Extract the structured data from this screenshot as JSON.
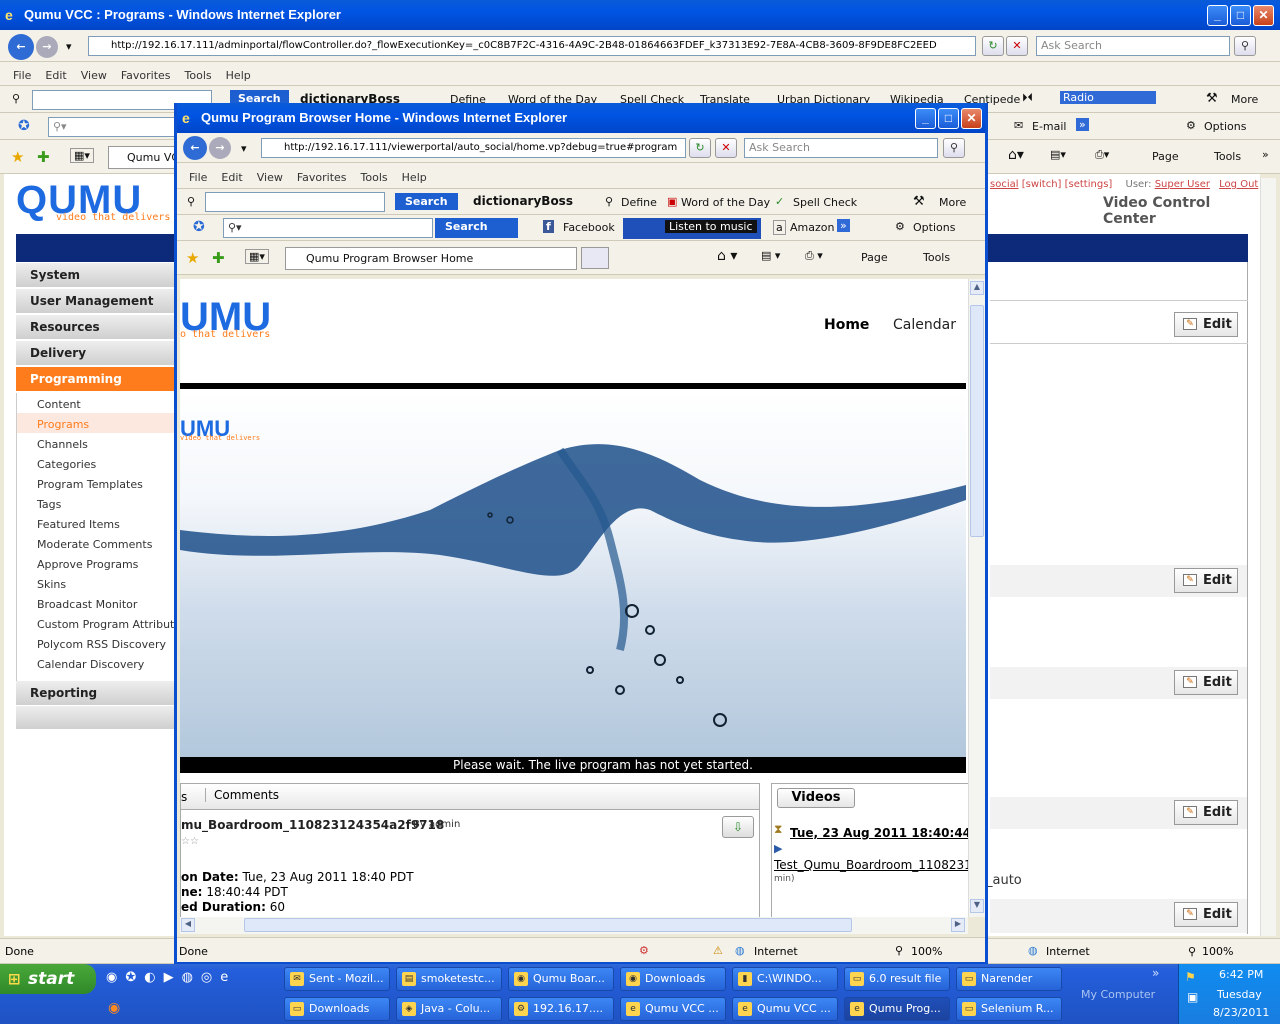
{
  "back": {
    "title": "Qumu VCC : Programs - Windows Internet Explorer",
    "url": "http://192.16.17.111/adminportal/flowController.do?_flowExecutionKey=_c0C8B7F2C-4316-4A9C-2B48-01864663FDEF_k37313E92-7E8A-4CB8-3609-8F9DE8FC2EED",
    "search_placeholder": "Ask Search",
    "menu": [
      "File",
      "Edit",
      "View",
      "Favorites",
      "Tools",
      "Help"
    ],
    "toolbar_search": "Search",
    "toolbar_items": [
      "dictionaryBoss",
      "Define",
      "Word of the Day",
      "Spell Check",
      "Translate",
      "Urban Dictionary",
      "Wikipedia",
      "Centipede"
    ],
    "radio": "Radio",
    "more": "More",
    "email": "E-mail",
    "options": "Options",
    "tab": "Qumu VC",
    "cmd": {
      "page": "Page",
      "tools": "Tools"
    },
    "header_links": {
      "social": "social",
      "switch": "[switch]",
      "settings": "[settings]",
      "user_label": "User:",
      "user": "Super User",
      "logout": "Log Out"
    },
    "app_title": "Video Control Center",
    "logo": "QUMU",
    "logo_tag": "video that delivers",
    "nav": [
      "System",
      "User Management",
      "Resources",
      "Delivery",
      "Programming"
    ],
    "subnav": [
      "Content",
      "Programs",
      "Channels",
      "Categories",
      "Program Templates",
      "Tags",
      "Featured Items",
      "Moderate Comments",
      "Approve Programs",
      "Skins",
      "Broadcast Monitor",
      "Custom Program Attributes",
      "Polycom RSS Discovery",
      "Calendar Discovery"
    ],
    "reporting": "Reporting",
    "edit": "Edit",
    "auto": "_auto",
    "status_done": "Done",
    "zone": "Internet",
    "zoom": "100%"
  },
  "front": {
    "title": "Qumu Program Browser Home - Windows Internet Explorer",
    "url": "http://192.16.17.111/viewerportal/auto_social/home.vp?debug=true#program",
    "search_placeholder": "Ask Search",
    "menu": [
      "File",
      "Edit",
      "View",
      "Favorites",
      "Tools",
      "Help"
    ],
    "search_btn": "Search",
    "toolbar_items": [
      "dictionaryBoss",
      "Define",
      "Word of the Day",
      "Spell Check"
    ],
    "more": "More",
    "search_ask": "Search",
    "facebook": "Facebook",
    "listen": "Listen to music",
    "amazon": "Amazon",
    "options": "Options",
    "tab": "Qumu Program Browser Home",
    "cmd": {
      "page": "Page",
      "tools": "Tools"
    },
    "logo": "UMU",
    "logo_tag": "o that delivers",
    "nav": {
      "home": "Home",
      "calendar": "Calendar"
    },
    "banner_logo": "UMU",
    "banner_tag": "video that delivers",
    "player_msg": "Please wait. The live program has not yet started.",
    "tabs": {
      "left": "s",
      "comments": "Comments",
      "videos": "Videos"
    },
    "program": {
      "title": "mu_Boardroom_110823124354a2f9718",
      "by": "By admin",
      "rating": "☆☆",
      "lines": [
        {
          "k": "on Date:",
          "v": "Tue, 23 Aug 2011 18:40 PDT"
        },
        {
          "k": "ne:",
          "v": "18:40:44 PDT"
        },
        {
          "k": "ed Duration:",
          "v": "60"
        }
      ]
    },
    "video": {
      "date": "Tue, 23 Aug 2011 18:40:44 PDT",
      "name": "Test_Qumu_Boardroom_1108231",
      "meta": "min)"
    },
    "status_done": "Done",
    "zone": "Internet",
    "zoom": "100%"
  },
  "taskbar": {
    "start": "start",
    "row1": [
      "Sent - Mozil...",
      "smoketestc...",
      "Qumu Boar...",
      "Downloads",
      "C:\\WINDO...",
      "6.0 result file",
      "Narender"
    ],
    "row2": [
      "Downloads",
      "Java - Colu...",
      "192.16.17....",
      "Qumu VCC ...",
      "Qumu VCC ...",
      "Qumu Prog...",
      "Selenium R..."
    ],
    "my_computer": "My Computer",
    "time": "6:42 PM",
    "day": "Tuesday",
    "date": "8/23/2011"
  }
}
